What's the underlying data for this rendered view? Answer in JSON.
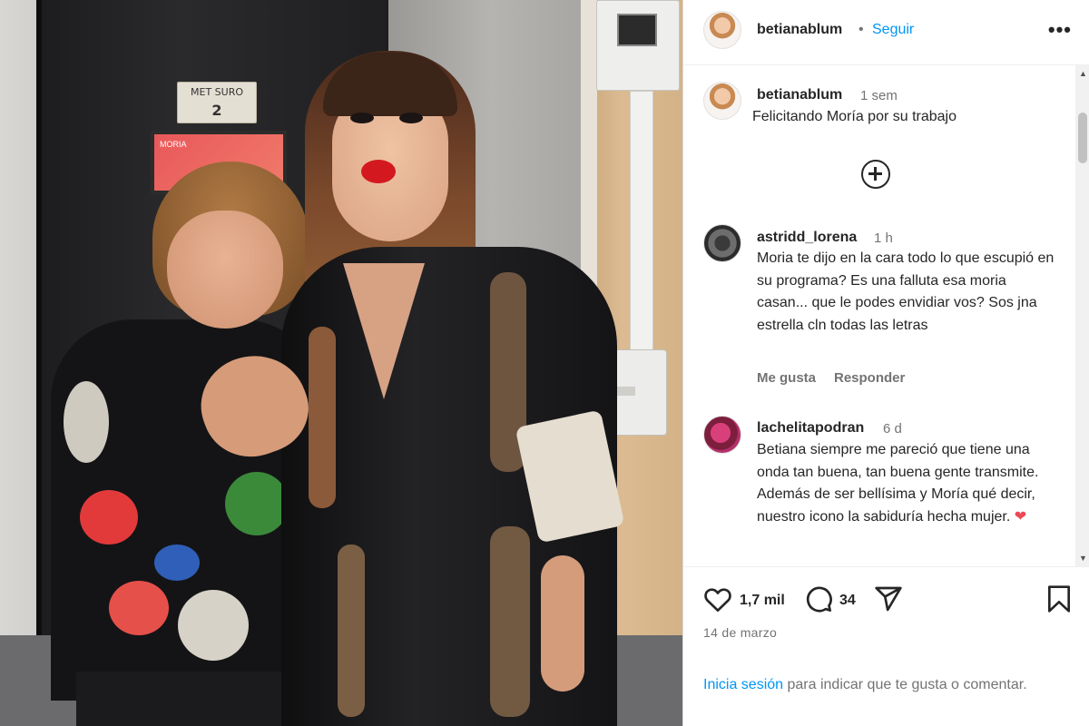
{
  "post": {
    "author": "betianablum",
    "follow_label": "Seguir",
    "separator": "•",
    "more_label": "•••"
  },
  "photo": {
    "sign_text": "MET SURO",
    "sign_number": "2",
    "poster_text": "MORIA"
  },
  "caption": {
    "username": "betianablum",
    "time": "1 sem",
    "text": "Felicitando Moría por su trabajo"
  },
  "comments": [
    {
      "username": "astridd_lorena",
      "time": "1 h",
      "text": "Moria te dijo en la cara todo lo que escupió en su programa? Es una falluta esa moria casan... que le podes envidiar vos? Sos jna estrella cln todas las letras",
      "like_label": "Me gusta",
      "reply_label": "Responder"
    },
    {
      "username": "lachelitapodran",
      "time": "6 d",
      "text": "Betiana siempre me pareció que tiene una onda tan buena, tan buena gente transmite. Además de ser bellísima y Moría qué decir, nuestro icono la sabiduría hecha mujer.",
      "emoji": "❤"
    }
  ],
  "actions": {
    "likes": "1,7 mil",
    "comments": "34",
    "date": "14 de marzo",
    "login_link": "Inicia sesión",
    "login_rest": " para indicar que te gusta o comentar."
  },
  "icons": [
    "heart-icon",
    "comment-icon",
    "share-icon",
    "bookmark-icon",
    "plus-circle-icon",
    "more-icon"
  ]
}
